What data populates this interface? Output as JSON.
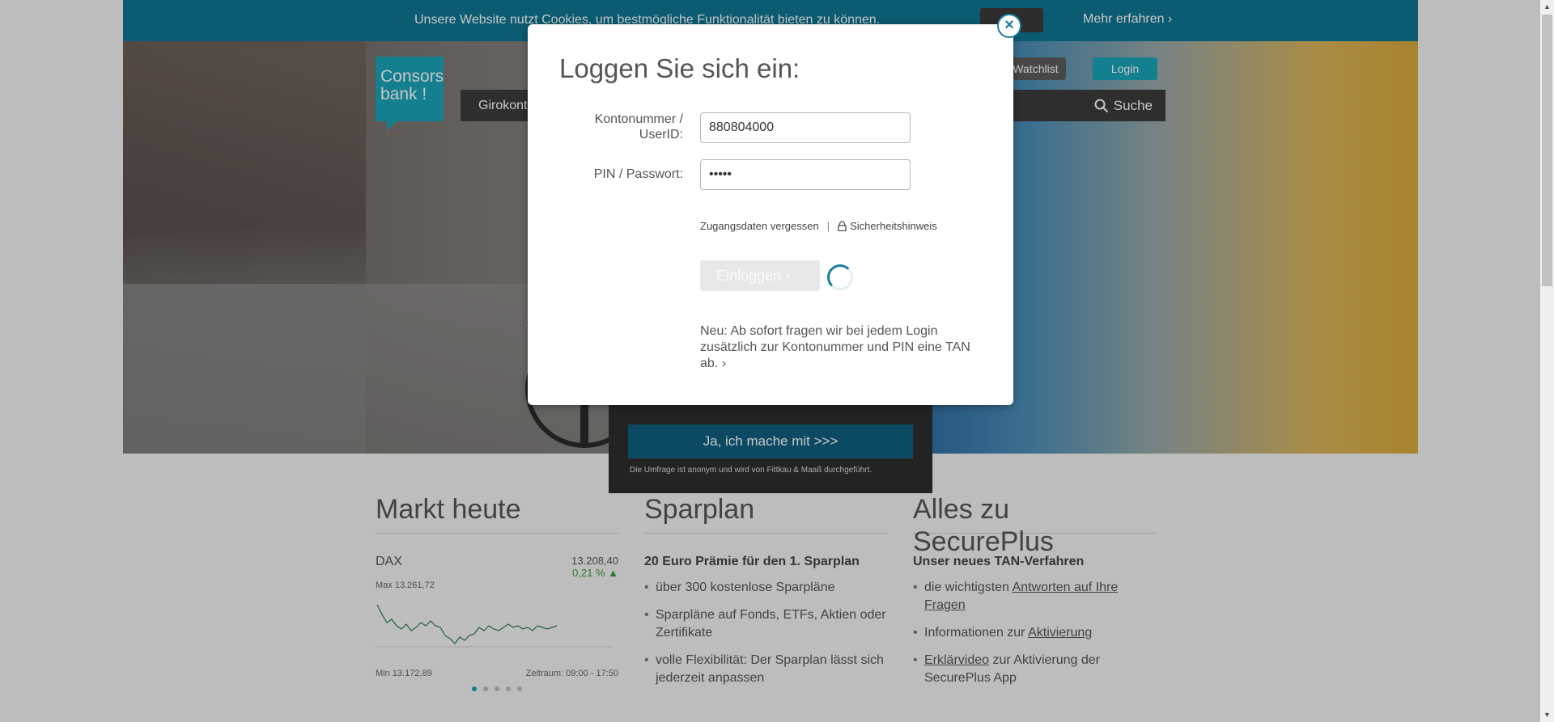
{
  "cookie_bar": {
    "text": "Unsere Website nutzt Cookies, um bestmögliche Funktionalität bieten zu können.",
    "more_link": "Mehr erfahren"
  },
  "header": {
    "logo_line1": "Consors",
    "logo_line2": "bank !",
    "nav_first": "Girokonto",
    "search_label": "Suche",
    "watchlist_label": "Watchlist",
    "login_label": "Login"
  },
  "survey": {
    "button_label": "Ja, ich mache mit >>>",
    "note": "Die Umfrage ist anonym und wird von Fittkau & Maaß durchgeführt."
  },
  "columns": {
    "markt": {
      "title": "Markt heute",
      "index_name": "DAX",
      "index_value": "13.208,40",
      "index_change": "0,21 % ▲",
      "max_label": "Max 13.261,72",
      "min_label": "Min 13.172,89",
      "period_label": "Zeitraum: 09:00 - 17:50"
    },
    "sparplan": {
      "title": "Sparplan",
      "subtitle": "20 Euro Prämie für den 1. Sparplan",
      "items": [
        "über 300 kostenlose Sparpläne",
        "Sparpläne auf Fonds, ETFs, Aktien oder Zertifikate",
        "volle Flexibilität: Der Sparplan lässt sich jederzeit anpassen"
      ]
    },
    "secureplus": {
      "title": "Alles zu SecurePlus",
      "subtitle": "Unser neues TAN-Verfahren",
      "item1_prefix": "die wichtigsten ",
      "item1_link": "Antworten auf Ihre Fragen",
      "item2_prefix": "Informationen zur ",
      "item2_link": "Aktivierung",
      "item3_link": "Erklärvideo",
      "item3_suffix": " zur Aktivierung der SecurePlus App"
    }
  },
  "login_modal": {
    "title": "Loggen Sie sich ein:",
    "account_label_line1": "Kontonummer /",
    "account_label_line2": "UserID:",
    "account_value": "880804000",
    "pin_label": "PIN / Passwort:",
    "pin_value": "•••••",
    "forgot_link": "Zugangsdaten vergessen",
    "separator": "|",
    "security_link": "Sicherheitshinweis",
    "submit_label": "Einloggen",
    "notice": "Neu: Ab sofort fragen wir bei jedem Login zusätzlich zur Kontonummer und PIN eine TAN ab.",
    "close_symbol": "×"
  },
  "hero": {
    "active_slide": 2,
    "slide_count": 5
  },
  "chart": {
    "active_page": 1,
    "page_count": 5
  },
  "colors": {
    "brand": "#1aa3b8",
    "cookie_bar": "#0f7593",
    "accent_dark": "#1a7fa0"
  }
}
